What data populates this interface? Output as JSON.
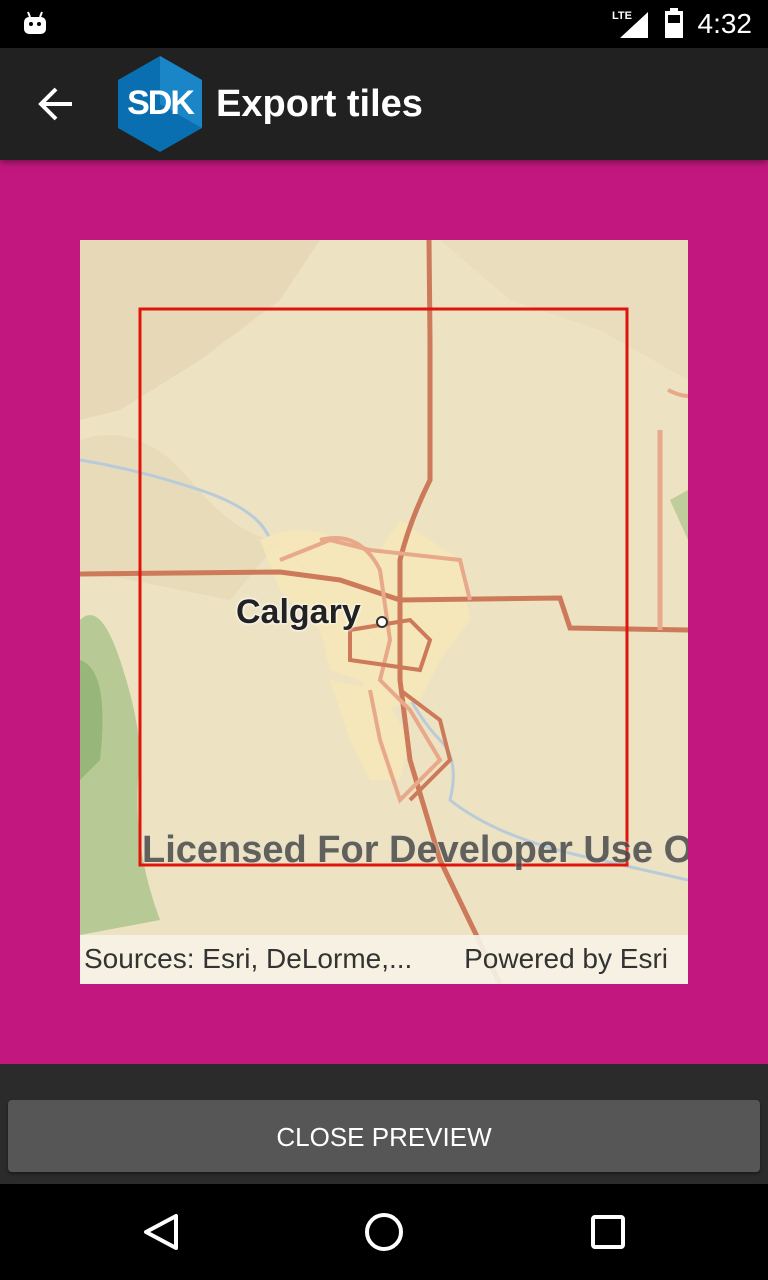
{
  "status_bar": {
    "network_label": "LTE",
    "time": "4:32",
    "icons": [
      "android-debug-icon",
      "signal-icon",
      "battery-icon"
    ]
  },
  "toolbar": {
    "logo_text": "SDK",
    "title": "Export tiles",
    "back_icon": "arrow-back-icon"
  },
  "map": {
    "city_label": "Calgary",
    "watermark": "Licensed For Developer Use Only",
    "attribution_sources": "Sources: Esri, DeLorme,...",
    "attribution_powered": "Powered by Esri",
    "extent_color": "#e0140c"
  },
  "actions": {
    "close_preview_label": "CLOSE PREVIEW"
  },
  "nav": {
    "icons": [
      "back-triangle-icon",
      "home-circle-icon",
      "recents-square-icon"
    ]
  },
  "colors": {
    "accent_background": "#c2177e",
    "toolbar": "#212121",
    "button": "#565656"
  }
}
